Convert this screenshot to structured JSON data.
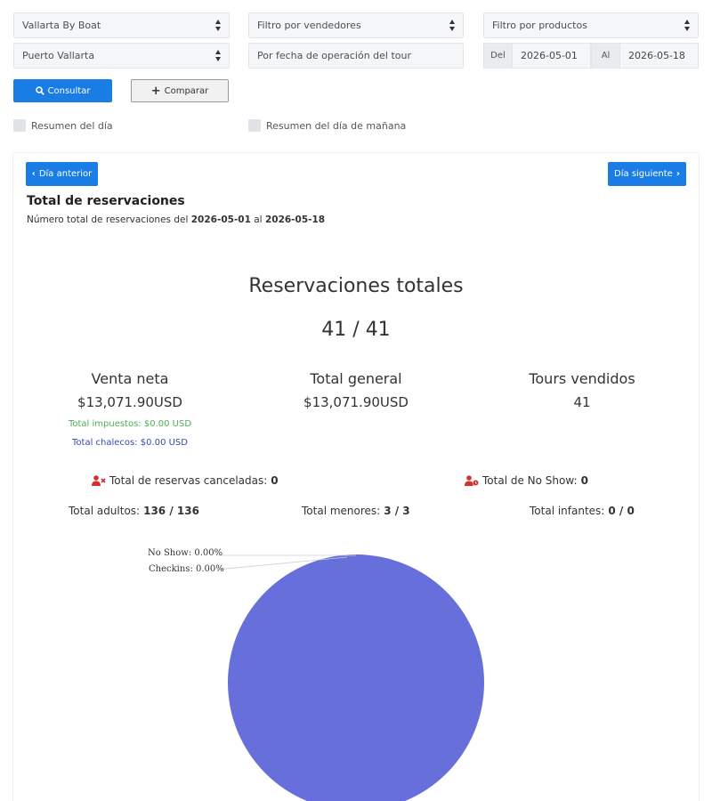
{
  "filters": {
    "agency": "Vallarta By Boat",
    "sellers": "Filtro por vendedores",
    "products": "Filtro por productos",
    "location": "Puerto Vallarta",
    "date_mode": "Por fecha de operación del tour",
    "from_label": "Del",
    "from_date": "2026-05-01",
    "to_label": "Al",
    "to_date": "2026-05-18"
  },
  "buttons": {
    "consultar": "Consultar",
    "comparar": "Comparar",
    "prev_day": "Día anterior",
    "next_day": "Día siguiente"
  },
  "checkboxes": {
    "today_summary": "Resumen del día",
    "tomorrow_summary": "Resumen del día de mañana"
  },
  "summary": {
    "title": "Total de reservaciones",
    "subtitle_prefix": "Número total de reservaciones del",
    "subtitle_from": "2026-05-01",
    "subtitle_mid": "al",
    "subtitle_to": "2026-05-18",
    "big_title": "Reservaciones totales",
    "big_count": "41 / 41",
    "net_sale_label": "Venta neta",
    "net_sale_value": "$13,071.90USD",
    "taxes": "Total impuestos: $0.00 USD",
    "vests": "Total chalecos: $0.00 USD",
    "general_label": "Total general",
    "general_value": "$13,071.90USD",
    "tours_label": "Tours vendidos",
    "tours_value": "41",
    "canceled_label": "Total de reservas canceladas:",
    "canceled_value": "0",
    "noshow_label": "Total de No Show:",
    "noshow_value": "0",
    "adults_label": "Total adultos:",
    "adults_value": "136 / 136",
    "minors_label": "Total menores:",
    "minors_value": "3 / 3",
    "infants_label": "Total infantes:",
    "infants_value": "0 / 0"
  },
  "chart_data": {
    "type": "pie",
    "slices": [
      {
        "label": "No Show",
        "value": 0.0,
        "text": "No Show: 0.00%"
      },
      {
        "label": "Checkins",
        "value": 0.0,
        "text": "Checkins: 0.00%"
      },
      {
        "label": "",
        "value": 100.0
      }
    ],
    "color": "#6770da"
  },
  "colors": {
    "primary": "#1a7de6",
    "danger_icon": "#d32f2f",
    "tax_green": "#4caf50",
    "vest_blue": "#3949ab"
  }
}
